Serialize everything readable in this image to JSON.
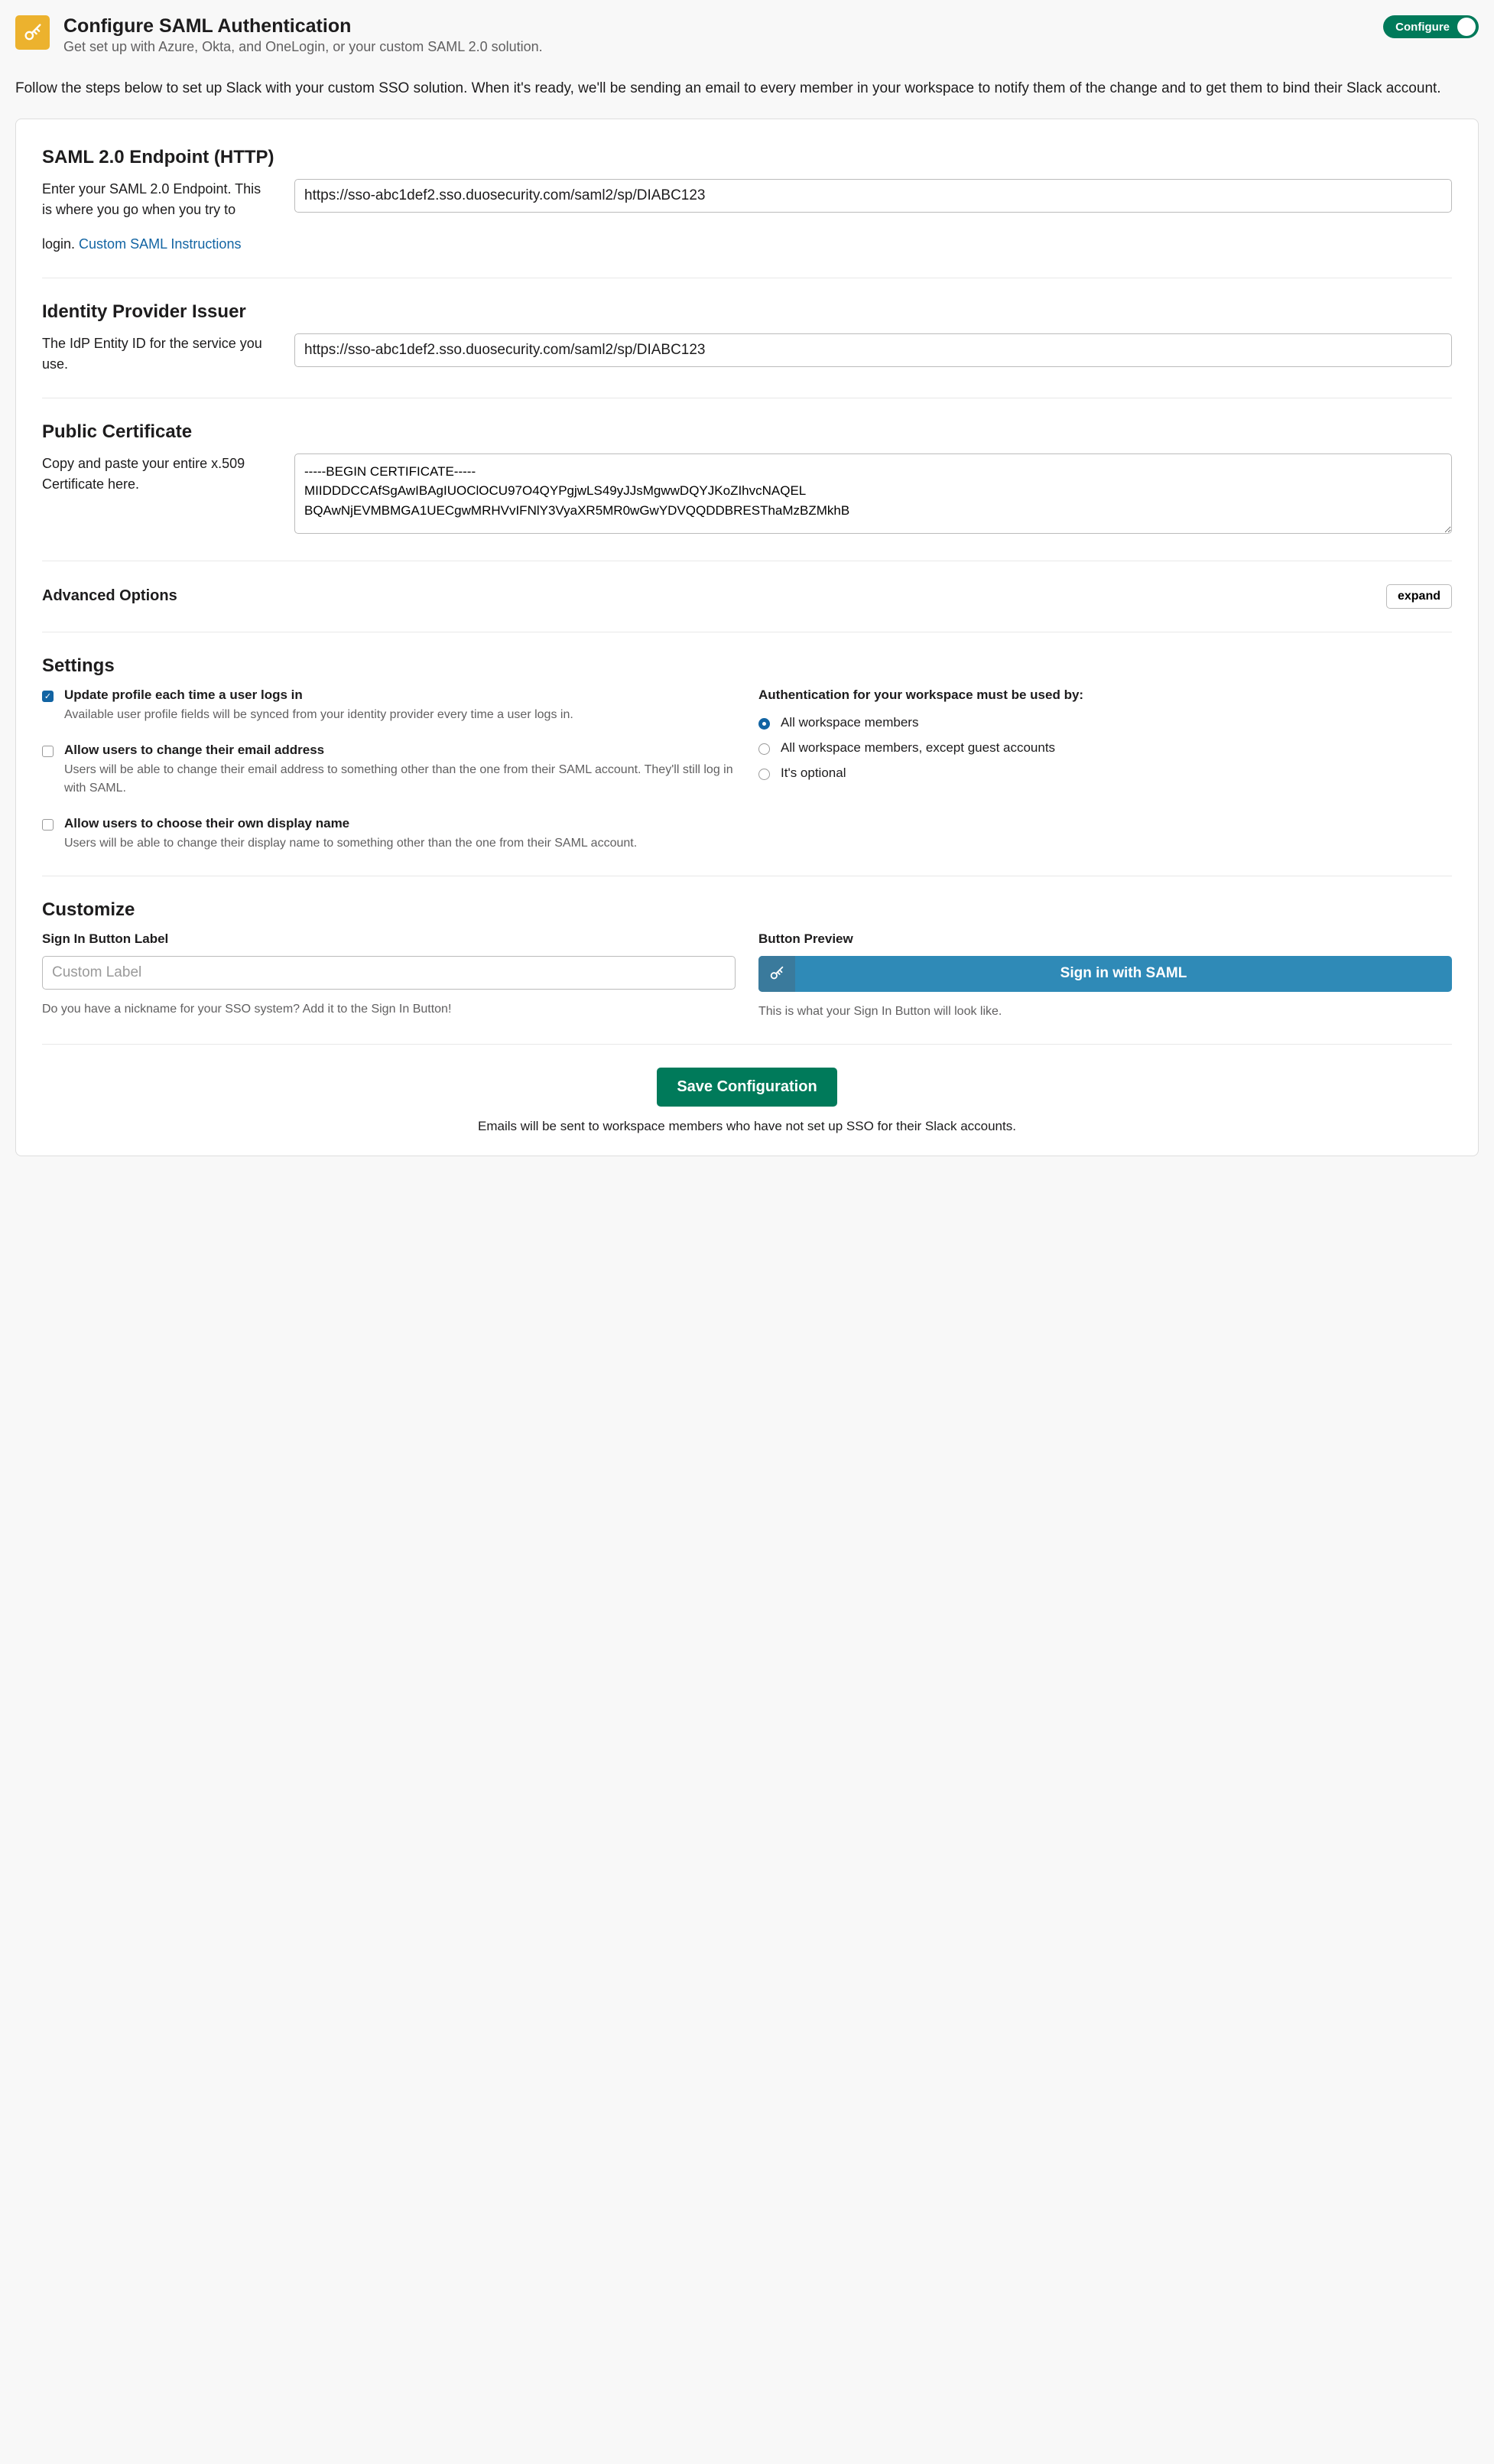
{
  "header": {
    "title": "Configure SAML Authentication",
    "subtitle": "Get set up with Azure, Okta, and OneLogin, or your custom SAML 2.0 solution.",
    "toggle_label": "Configure"
  },
  "intro": "Follow the steps below to set up Slack with your custom SSO solution. When it's ready, we'll be sending an email to every member in your workspace to notify them of the change and to get them to bind their Slack account.",
  "endpoint": {
    "heading": "SAML 2.0 Endpoint (HTTP)",
    "desc": "Enter your SAML 2.0 Endpoint. This is where you go when you try to login.",
    "link": "Custom SAML Instructions",
    "value": "https://sso-abc1def2.sso.duosecurity.com/saml2/sp/DIABC123"
  },
  "issuer": {
    "heading": "Identity Provider Issuer",
    "desc": "The IdP Entity ID for the service you use.",
    "value": "https://sso-abc1def2.sso.duosecurity.com/saml2/sp/DIABC123"
  },
  "cert": {
    "heading": "Public Certificate",
    "desc": "Copy and paste your entire x.509 Certificate here.",
    "value": "-----BEGIN CERTIFICATE-----\nMIIDDDCCAfSgAwIBAgIUOClOCU97O4QYPgjwLS49yJJsMgwwDQYJKoZIhvcNAQEL\nBQAwNjEVMBMGA1UECgwMRHVvIFNlY3VyaXR5MR0wGwYDVQQDDBRESThaMzBZMkhB"
  },
  "advanced": {
    "heading": "Advanced Options",
    "button": "expand"
  },
  "settings": {
    "heading": "Settings",
    "checks": [
      {
        "label": "Update profile each time a user logs in",
        "sub": "Available user profile fields will be synced from your identity provider every time a user logs in.",
        "checked": true
      },
      {
        "label": "Allow users to change their email address",
        "sub": "Users will be able to change their email address to something other than the one from their SAML account. They'll still log in with SAML.",
        "checked": false
      },
      {
        "label": "Allow users to choose their own display name",
        "sub": "Users will be able to change their display name to something other than the one from their SAML account.",
        "checked": false
      }
    ],
    "auth_header": "Authentication for your workspace must be used by:",
    "radios": [
      {
        "label": "All workspace members",
        "checked": true
      },
      {
        "label": "All workspace members, except guest accounts",
        "checked": false
      },
      {
        "label": "It's optional",
        "checked": false
      }
    ]
  },
  "customize": {
    "heading": "Customize",
    "label_field": "Sign In Button Label",
    "label_placeholder": "Custom Label",
    "label_helper": "Do you have a nickname for your SSO system? Add it to the Sign In Button!",
    "preview_field": "Button Preview",
    "preview_label": "Sign in with SAML",
    "preview_helper": "This is what your Sign In Button will look like."
  },
  "footer": {
    "save": "Save Configuration",
    "note": "Emails will be sent to workspace members who have not set up SSO for their Slack accounts."
  }
}
